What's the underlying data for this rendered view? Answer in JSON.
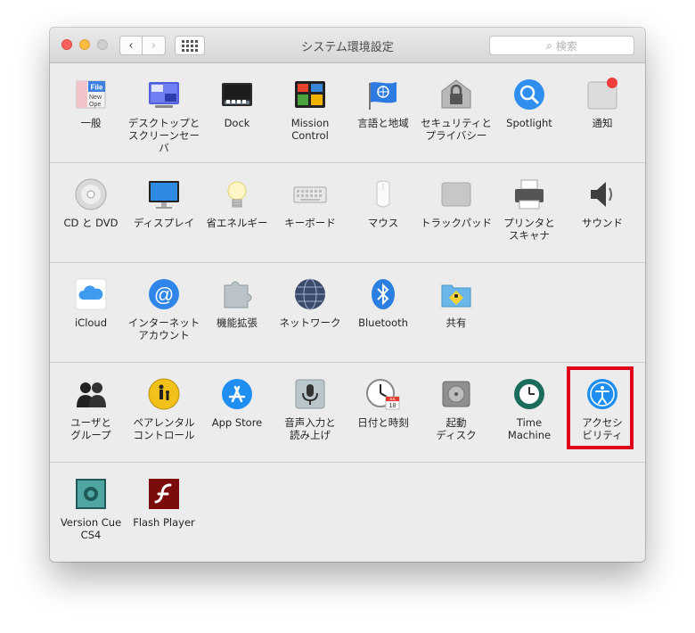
{
  "window": {
    "title": "システム環境設定"
  },
  "toolbar": {
    "back": "‹",
    "forward": "›"
  },
  "search": {
    "placeholder": "検索",
    "icon": "search-icon"
  },
  "rows": [
    [
      {
        "id": "general",
        "label": "一般",
        "icon_text": "File",
        "icon_lines": [
          "New",
          "Ope"
        ]
      },
      {
        "id": "desktop",
        "label": "デスクトップと\nスクリーンセーバ"
      },
      {
        "id": "dock",
        "label": "Dock"
      },
      {
        "id": "mission-control",
        "label": "Mission\nControl"
      },
      {
        "id": "language",
        "label": "言語と地域"
      },
      {
        "id": "security",
        "label": "セキュリティと\nプライバシー"
      },
      {
        "id": "spotlight",
        "label": "Spotlight"
      },
      {
        "id": "notifications",
        "label": "通知"
      }
    ],
    [
      {
        "id": "cd-dvd",
        "label": "CD と DVD"
      },
      {
        "id": "displays",
        "label": "ディスプレイ"
      },
      {
        "id": "energy",
        "label": "省エネルギー"
      },
      {
        "id": "keyboard",
        "label": "キーボード"
      },
      {
        "id": "mouse",
        "label": "マウス"
      },
      {
        "id": "trackpad",
        "label": "トラックパッド"
      },
      {
        "id": "printers",
        "label": "プリンタと\nスキャナ"
      },
      {
        "id": "sound",
        "label": "サウンド"
      }
    ],
    [
      {
        "id": "icloud",
        "label": "iCloud"
      },
      {
        "id": "internet-accounts",
        "label": "インターネット\nアカウント",
        "icon_text": "@"
      },
      {
        "id": "extensions",
        "label": "機能拡張"
      },
      {
        "id": "network",
        "label": "ネットワーク"
      },
      {
        "id": "bluetooth",
        "label": "Bluetooth"
      },
      {
        "id": "sharing",
        "label": "共有"
      }
    ],
    [
      {
        "id": "users",
        "label": "ユーザと\nグループ"
      },
      {
        "id": "parental",
        "label": "ペアレンタル\nコントロール"
      },
      {
        "id": "app-store",
        "label": "App Store"
      },
      {
        "id": "dictation",
        "label": "音声入力と\n読み上げ"
      },
      {
        "id": "date-time",
        "label": "日付と時刻",
        "icon_text": "JUL",
        "icon_day": "18"
      },
      {
        "id": "startup-disk",
        "label": "起動\nディスク"
      },
      {
        "id": "time-machine",
        "label": "Time\nMachine"
      },
      {
        "id": "accessibility",
        "label": "アクセシ\nビリティ"
      }
    ],
    [
      {
        "id": "version-cue",
        "label": "Version Cue\nCS4"
      },
      {
        "id": "flash",
        "label": "Flash Player"
      }
    ]
  ],
  "highlight": {
    "item": "accessibility",
    "color": "#e0001a"
  }
}
